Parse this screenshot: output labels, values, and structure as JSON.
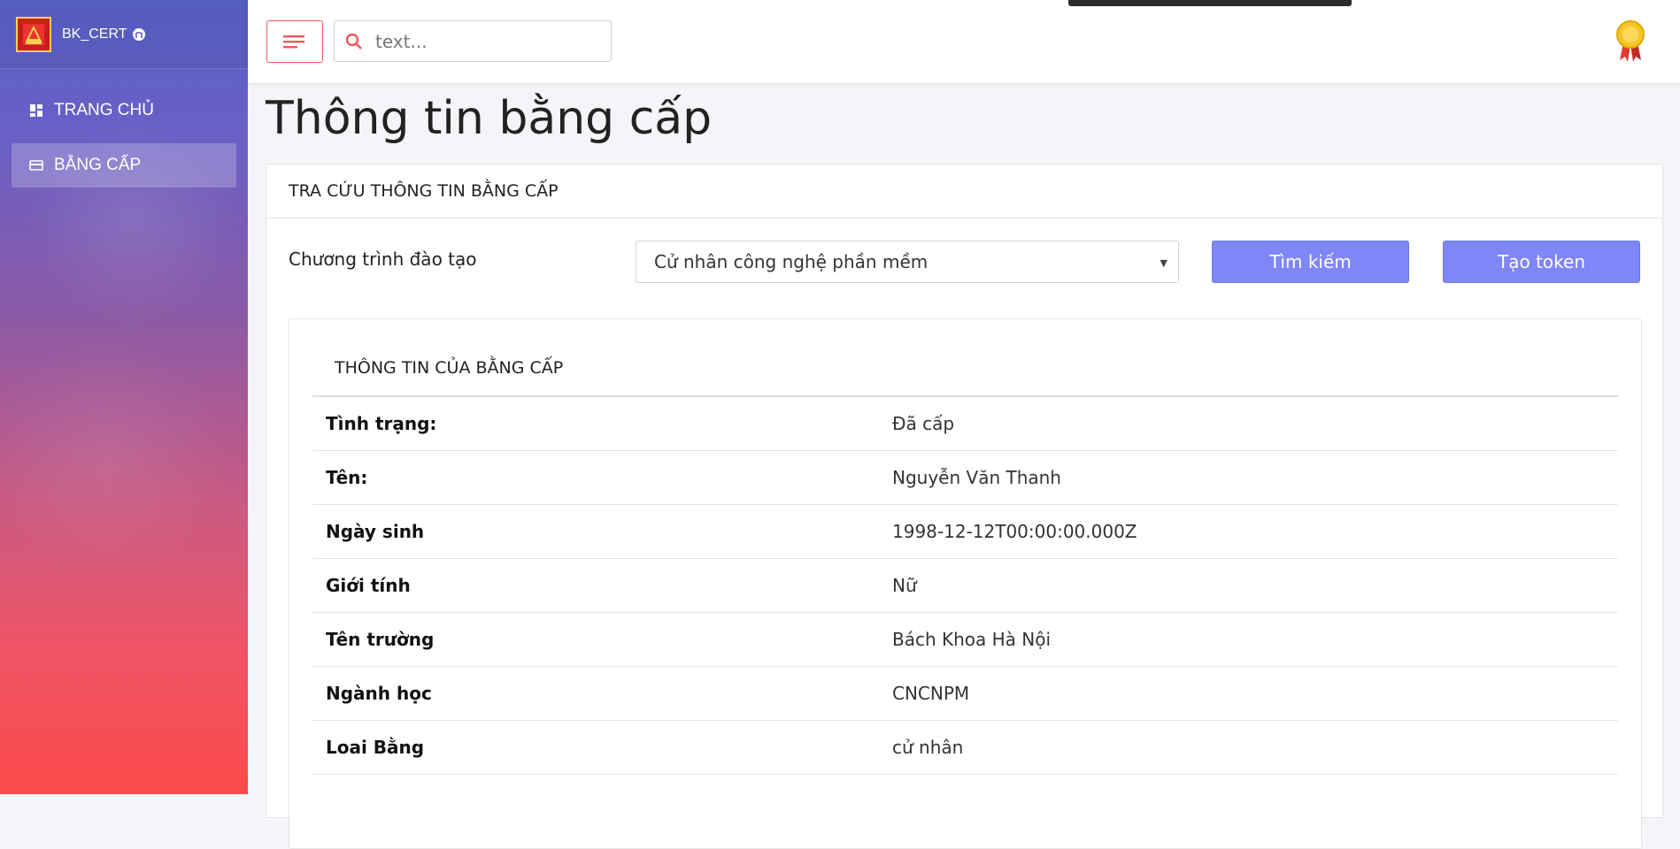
{
  "brand": {
    "name": "BK_CERT",
    "logo_icon": "bach-khoa-logo",
    "github_icon": "github-icon"
  },
  "sidebar": {
    "items": [
      {
        "label": "TRANG CHỦ",
        "icon": "dashboard-icon",
        "active": false
      },
      {
        "label": "BẰNG CẤP",
        "icon": "card-icon",
        "active": true
      }
    ]
  },
  "topbar": {
    "search": {
      "placeholder": "text..."
    },
    "award_icon": "award-medal-icon"
  },
  "page": {
    "title": "Thông tin bằng cấp"
  },
  "lookup": {
    "header": "TRA CỨU THÔNG TIN BẰNG CẤP",
    "program_label": "Chương trình đào tạo",
    "program_selected": "Cử nhân công nghệ phần mềm",
    "search_button": "Tìm kiếm",
    "token_button": "Tạo token"
  },
  "certificate": {
    "title": "THÔNG TIN CỦA BẰNG CẤP",
    "rows": [
      {
        "key": "Tình trạng:",
        "value": "Đã cấp"
      },
      {
        "key": "Tên:",
        "value": "Nguyễn Văn Thanh"
      },
      {
        "key": "Ngày sinh",
        "value": "1998-12-12T00:00:00.000Z"
      },
      {
        "key": "Giới tính",
        "value": "Nữ"
      },
      {
        "key": "Tên trường",
        "value": "Bách Khoa Hà Nội"
      },
      {
        "key": "Ngành học",
        "value": "CNCNPM"
      },
      {
        "key": "Loai Bằng",
        "value": "cử nhân"
      }
    ]
  },
  "colors": {
    "primary_button": "#7f86f5",
    "menu_border": "#e85a5a",
    "sidebar_top": "#5a63cc",
    "sidebar_bottom": "#fb4a4a"
  }
}
